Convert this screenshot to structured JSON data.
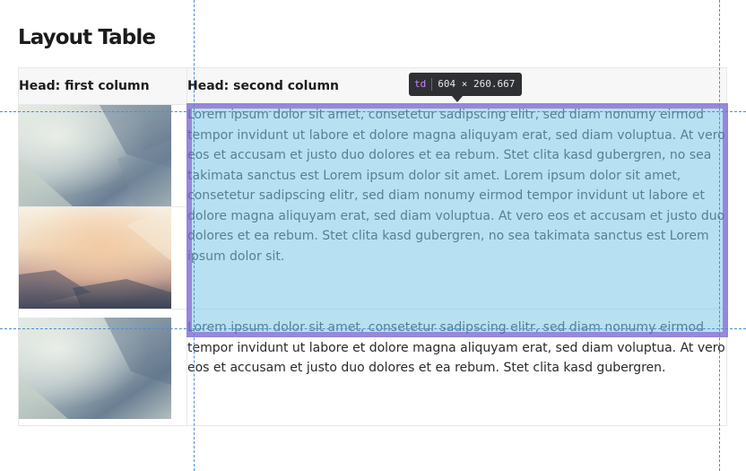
{
  "page": {
    "title": "Layout Table"
  },
  "table": {
    "headers": [
      "Head: first column",
      "Head: second column"
    ],
    "rows": [
      {
        "image": "blurred-polygon-bluegray-image",
        "text": "Lorem ipsum dolor sit amet, consetetur sadipscing elitr, sed diam nonumy eirmod tempor invidunt ut labore et dolore magna aliquyam erat, sed diam voluptua. At vero eos et accusam et justo duo dolores et ea rebum. Stet clita kasd gubergren, no sea takimata sanctus est Lorem ipsum dolor sit amet. Lorem ipsum dolor sit amet, consetetur sadipscing elitr, sed diam nonumy eirmod tempor invidunt ut labore et dolore magna aliquyam erat, sed diam voluptua. At vero eos et accusam et justo duo dolores et ea rebum. Stet clita kasd gubergren, no sea takimata sanctus est Lorem ipsum dolor sit."
      },
      {
        "image": "blurred-polygon-sunset-image"
      },
      {
        "image": "blurred-polygon-bluegray-image",
        "text": "Lorem ipsum dolor sit amet, consetetur sadipscing elitr, sed diam nonumy eirmod tempor invidunt ut labore et dolore magna aliquyam erat, sed diam voluptua. At vero eos et accusam et justo duo dolores et ea rebum. Stet clita kasd gubergren."
      }
    ]
  },
  "devtools": {
    "tooltip": {
      "tag": "td",
      "dimensions": "604 × 260.667"
    },
    "colors": {
      "highlight_fill": "#7cc6e8",
      "highlight_border": "#806ed2",
      "guide": "#4a8fd0",
      "tooltip_bg": "#2f3033"
    }
  }
}
